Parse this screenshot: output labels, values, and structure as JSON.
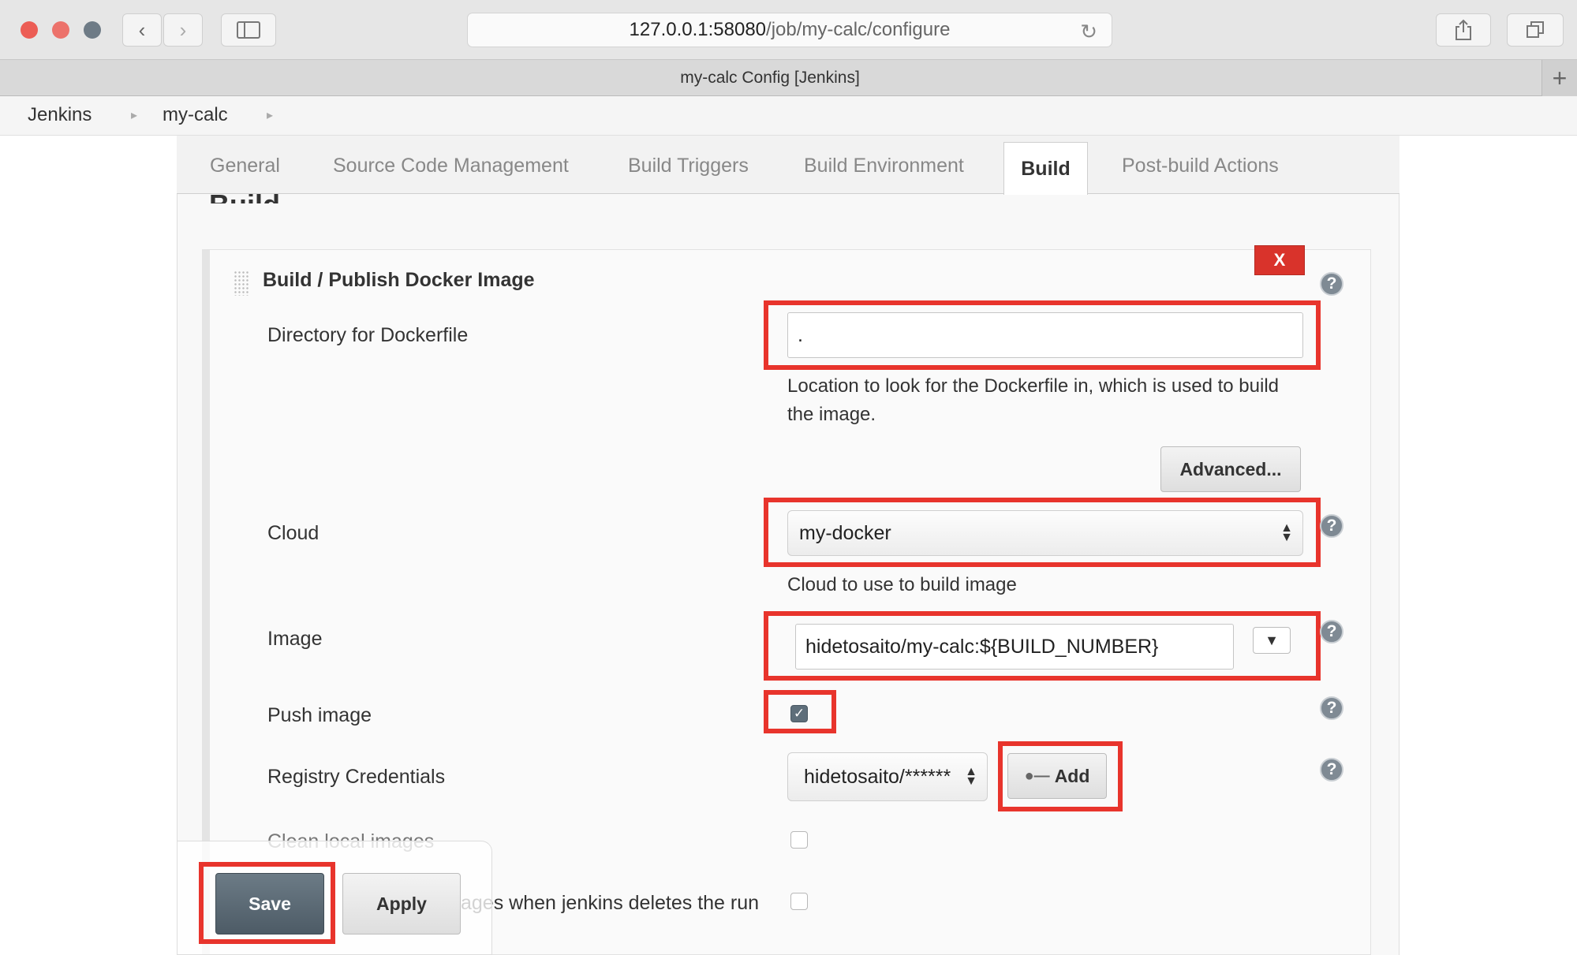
{
  "browser": {
    "url_host": "127.0.0.1:58080",
    "url_path": "/job/my-calc/configure",
    "tab_title": "my-calc Config [Jenkins]"
  },
  "breadcrumb": [
    "Jenkins",
    "my-calc"
  ],
  "config_tabs": [
    "General",
    "Source Code Management",
    "Build Triggers",
    "Build Environment",
    "Build",
    "Post-build Actions"
  ],
  "active_tab": "Build",
  "section_heading": "Build",
  "build_step": {
    "title": "Build / Publish Docker Image",
    "delete_label": "X",
    "directory": {
      "label": "Directory for Dockerfile",
      "value": ".",
      "description": "Location to look for the Dockerfile in, which is used to build the image."
    },
    "advanced_label": "Advanced...",
    "cloud": {
      "label": "Cloud",
      "value": "my-docker",
      "description": "Cloud to use to build image"
    },
    "image": {
      "label": "Image",
      "value": "hidetosaito/my-calc:${BUILD_NUMBER}"
    },
    "push_image": {
      "label": "Push image",
      "checked": true
    },
    "registry_credentials": {
      "label": "Registry Credentials",
      "value": "hidetosaito/******",
      "add_label": "Add"
    },
    "clean_local_images": {
      "label": "Clean local images",
      "checked": false
    },
    "clean_on_delete": {
      "label_visible": "ages when jenkins deletes the run",
      "checked": false
    }
  },
  "actions": {
    "save_label": "Save",
    "apply_label": "Apply"
  },
  "colors": {
    "highlight": "#e8342c",
    "delete": "#d9332b",
    "save": "#56646f"
  }
}
